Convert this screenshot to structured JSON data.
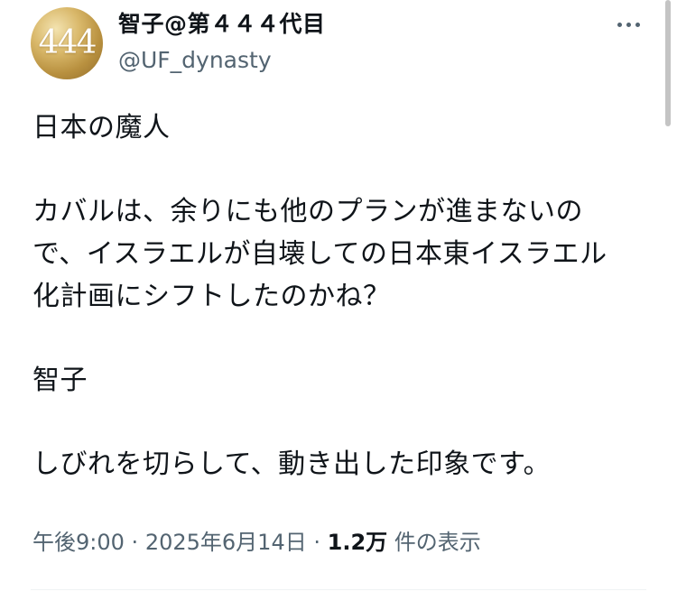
{
  "author": {
    "avatar_text": "444",
    "display_name": "智子@第４４４代目",
    "handle": "@UF_dynasty"
  },
  "tweet": {
    "paragraphs": [
      [
        "日本の魔人"
      ],
      [
        "カバルは、余りにも他のプランが進まないの",
        "で、イスラエルが自壊しての日本東イスラエル",
        "化計画にシフトしたのかね？"
      ],
      [
        "智子"
      ],
      [
        "しびれを切らして、動き出した印象です。"
      ]
    ]
  },
  "meta": {
    "time": "午後9:00",
    "separator": "·",
    "date": "2025年6月14日",
    "views_count": "1.2万",
    "views_label": "件の表示"
  },
  "icons": {
    "more": "more-horizontal-icon"
  },
  "colors": {
    "text": "#0f1419",
    "secondary": "#536471",
    "avatar_gold": "#c9a24e",
    "divider": "#eff3f4"
  }
}
